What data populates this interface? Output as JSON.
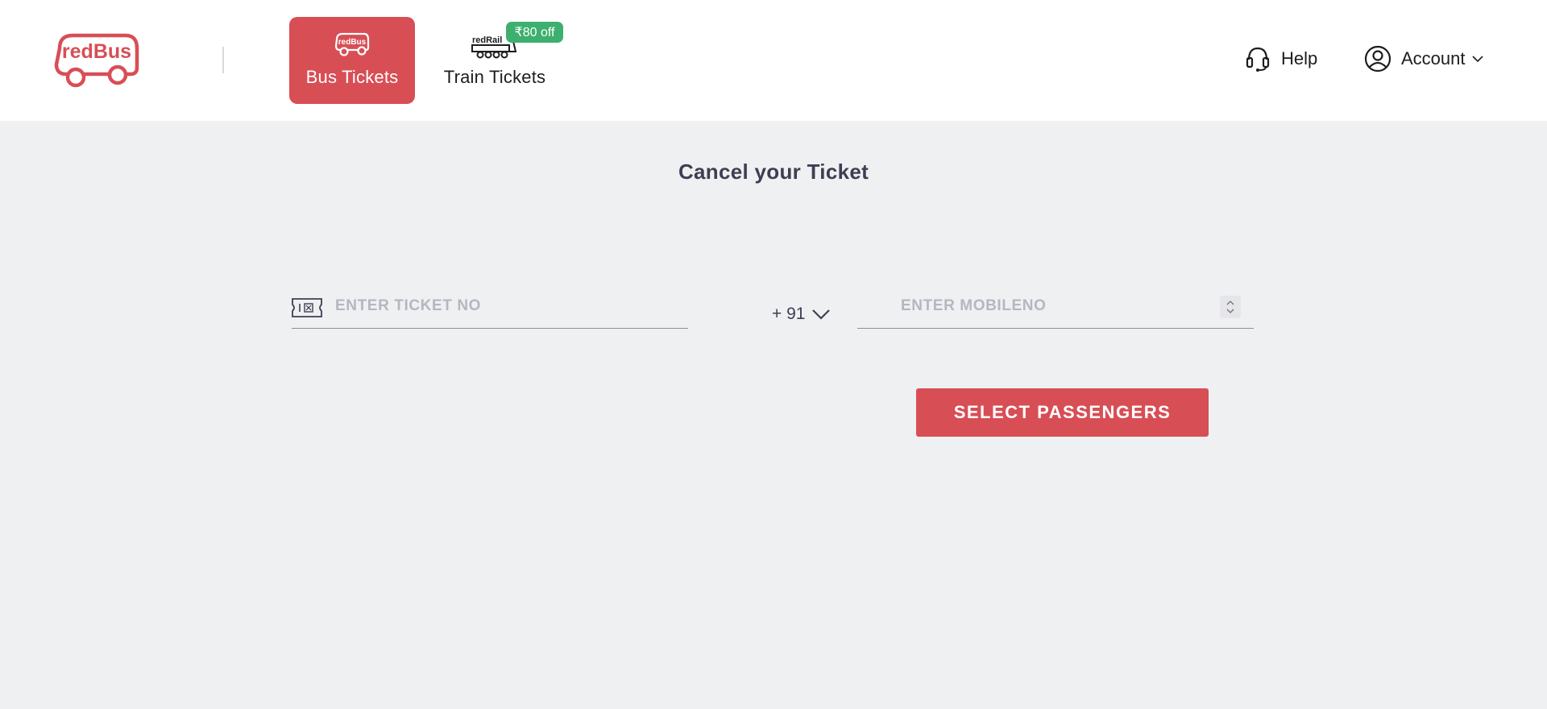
{
  "header": {
    "logo_text": "redBus",
    "tabs": [
      {
        "label": "Bus Tickets",
        "icon": "bus-icon",
        "icon_text": "redBus",
        "active": true
      },
      {
        "label": "Train Tickets",
        "icon": "train-icon",
        "icon_text": "redRail",
        "active": false
      }
    ],
    "offer_badge": "₹80 off",
    "help_label": "Help",
    "account_label": "Account"
  },
  "main": {
    "title": "Cancel your Ticket",
    "ticket_placeholder": "ENTER TICKET NO",
    "country_code": "+ 91",
    "mobile_placeholder": "ENTER MOBILENO",
    "submit_label": "SELECT PASSENGERS"
  },
  "colors": {
    "brand": "#d84e55",
    "offer": "#3daf6e",
    "background": "#eff0f2"
  }
}
